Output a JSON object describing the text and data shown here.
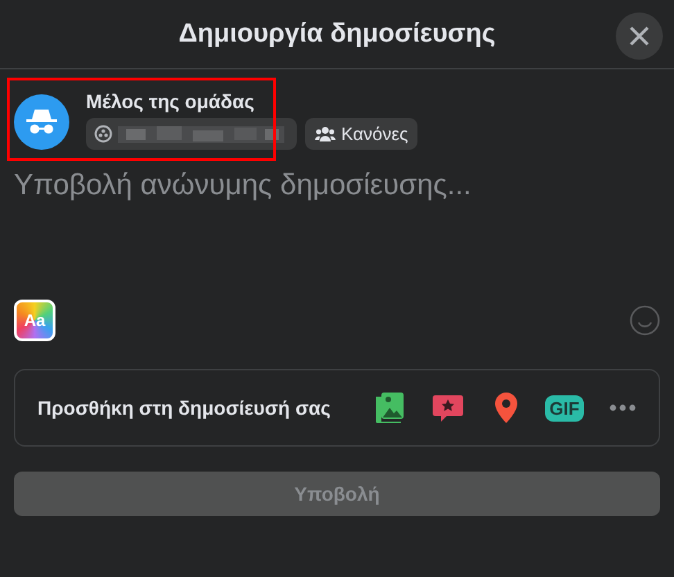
{
  "dialog": {
    "title": "Δημιουργία δημοσίευσης"
  },
  "author": {
    "name": "Μέλος της ομάδας",
    "highlighted": true,
    "audience_button": {
      "blurred": true
    },
    "rules_button": {
      "label": "Κανόνες"
    }
  },
  "composer": {
    "placeholder": "Υποβολή ανώνυμης δημοσίευσης..."
  },
  "text_format_button": {
    "label": "Aa"
  },
  "add_to_post": {
    "label": "Προσθήκη στη δημοσίευσή σας",
    "tools": [
      {
        "kind": "photo"
      },
      {
        "kind": "tag"
      },
      {
        "kind": "location"
      },
      {
        "kind": "gif",
        "label": "GIF"
      },
      {
        "kind": "more"
      }
    ]
  },
  "submit_button": {
    "label": "Υποβολή",
    "disabled": true
  }
}
